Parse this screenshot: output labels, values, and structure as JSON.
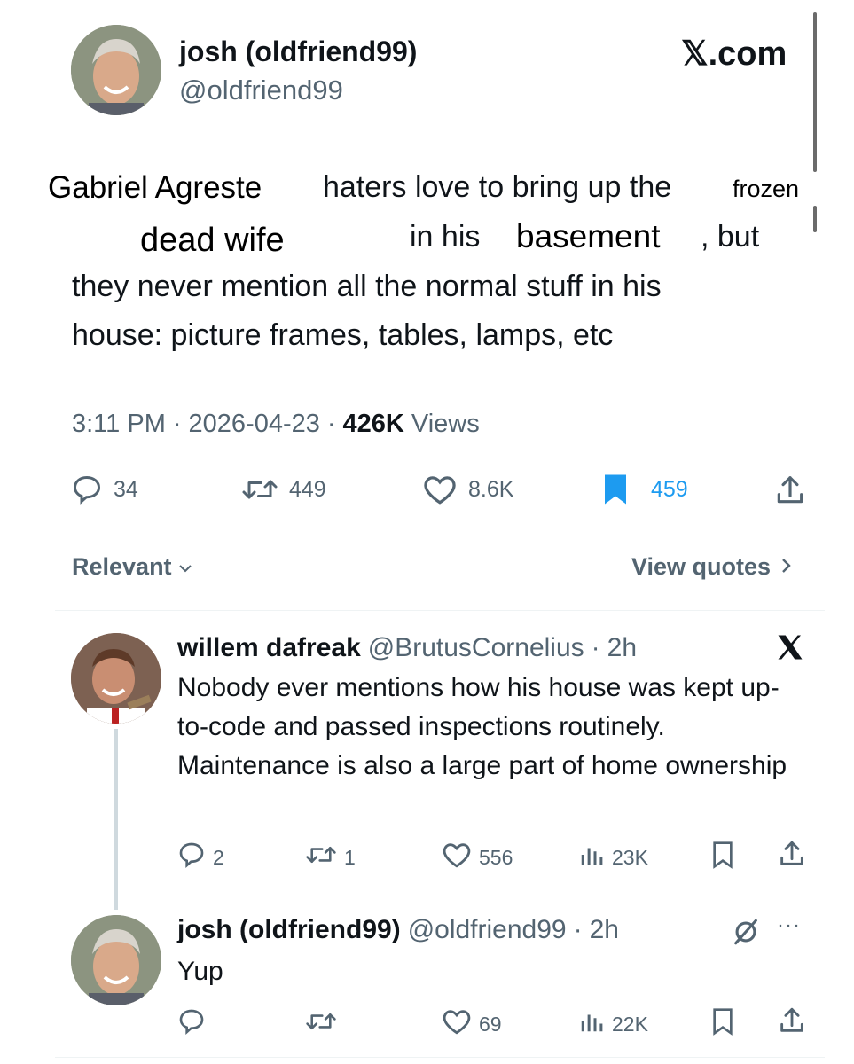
{
  "colors": {
    "text_primary": "#0f1419",
    "text_secondary": "#536471",
    "accent_blue": "#1d9bf0",
    "bookmark_active": "#1d9bf0",
    "divider": "#eff3f4"
  },
  "brand": {
    "site_label": "𝕏.com"
  },
  "main_tweet": {
    "author_name": "josh (oldfriend99)",
    "author_handle": "@oldfriend99",
    "text_parts": {
      "sticker_gabriel": "Gabriel Agreste",
      "segment_1": "haters love to bring up the",
      "sticker_frozen": "frozen",
      "sticker_dead_wife": "dead wife",
      "segment_2": "in his",
      "sticker_basement": "basement",
      "segment_3": ", but",
      "line_3": "they never mention all the normal stuff in his",
      "line_4": "house: picture frames, tables, lamps, etc"
    },
    "time": "3:11 PM",
    "date": "2026-04-23",
    "views_count": "426K",
    "views_label": "Views",
    "stats": {
      "replies": "34",
      "reposts": "449",
      "likes": "8.6K",
      "bookmarks": "459"
    },
    "icons": [
      "reply-icon",
      "repost-icon",
      "like-icon",
      "bookmark-filled-icon",
      "share-icon"
    ]
  },
  "sort_bar": {
    "sort_label": "Relevant",
    "view_quotes_label": "View quotes"
  },
  "replies": [
    {
      "author_name": "willem dafreak",
      "author_handle": "@BrutusCornelius",
      "time_ago": "2h",
      "text": "Nobody ever mentions how his house was kept up-to-code and passed inspections routinely. Maintenance is also a large part of home ownership",
      "stats": {
        "replies": "2",
        "reposts": "1",
        "likes": "556",
        "views": "23K"
      }
    },
    {
      "author_name": "josh (oldfriend99)",
      "author_handle": "@oldfriend99",
      "time_ago": "2h",
      "text": "Yup",
      "stats": {
        "replies": "",
        "reposts": "",
        "likes": "69",
        "views": "22K"
      },
      "more_label": "···"
    }
  ]
}
